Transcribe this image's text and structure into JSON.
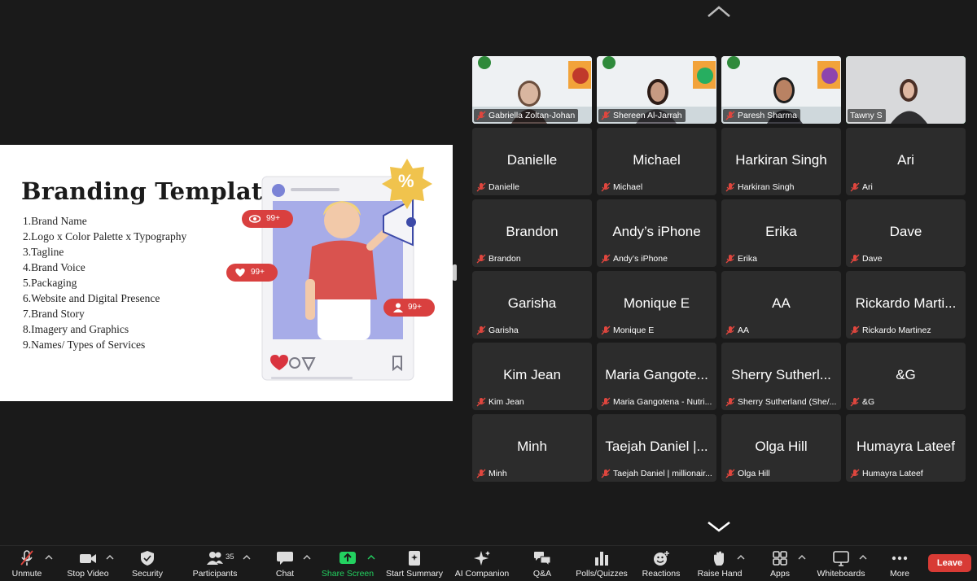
{
  "slide": {
    "title": "Branding Template",
    "items": [
      "1.Brand Name",
      "2.Logo x Color Palette x Typography",
      "3.Tagline",
      "4.Brand Voice",
      "5.Packaging",
      "6.Website and Digital Presence",
      "7.Brand Story",
      "8.Imagery and Graphics",
      "9.Names/ Types of Services"
    ],
    "badges": {
      "views": "99+",
      "likes": "99+",
      "followers": "99+"
    },
    "percent": "%"
  },
  "video_tiles": [
    {
      "label": "Gabriella Zoltan-Johan"
    },
    {
      "label": "Shereen Al-Jarrah"
    },
    {
      "label": "Paresh Sharma"
    },
    {
      "label": "Tawny S"
    }
  ],
  "tiles": [
    {
      "display": "Danielle",
      "label": "Danielle"
    },
    {
      "display": "Michael",
      "label": "Michael"
    },
    {
      "display": "Harkiran Singh",
      "label": "Harkiran Singh"
    },
    {
      "display": "Ari",
      "label": "Ari"
    },
    {
      "display": "Brandon",
      "label": "Brandon"
    },
    {
      "display": "Andy’s iPhone",
      "label": "Andy’s iPhone"
    },
    {
      "display": "Erika",
      "label": "Erika"
    },
    {
      "display": "Dave",
      "label": "Dave"
    },
    {
      "display": "Garisha",
      "label": "Garisha"
    },
    {
      "display": "Monique E",
      "label": "Monique E"
    },
    {
      "display": "AA",
      "label": "AA"
    },
    {
      "display": "Rickardo Marti...",
      "label": "Rickardo Martinez"
    },
    {
      "display": "Kim Jean",
      "label": "Kim Jean"
    },
    {
      "display": "Maria Gangote...",
      "label": "Maria Gangotena - Nutri..."
    },
    {
      "display": "Sherry Sutherl...",
      "label": "Sherry Sutherland (She/..."
    },
    {
      "display": "&G",
      "label": "&G"
    },
    {
      "display": "Minh",
      "label": "Minh"
    },
    {
      "display": "Taejah Daniel |...",
      "label": "Taejah Daniel | millionair..."
    },
    {
      "display": "Olga Hill",
      "label": "Olga Hill"
    },
    {
      "display": "Humayra Lateef",
      "label": "Humayra Lateef"
    }
  ],
  "toolbar": {
    "unmute": "Unmute",
    "stop_video": "Stop Video",
    "security": "Security",
    "participants": "Participants",
    "participants_count": "35",
    "chat": "Chat",
    "share_screen": "Share Screen",
    "start_summary": "Start Summary",
    "ai_companion": "AI Companion",
    "qa": "Q&A",
    "polls": "Polls/Quizzes",
    "reactions": "Reactions",
    "raise_hand": "Raise Hand",
    "apps": "Apps",
    "whiteboards": "Whiteboards",
    "more": "More",
    "leave": "Leave"
  },
  "colors": {
    "accent_green": "#23d160",
    "leave_red": "#d83b35",
    "mute_red": "#e0463e"
  }
}
